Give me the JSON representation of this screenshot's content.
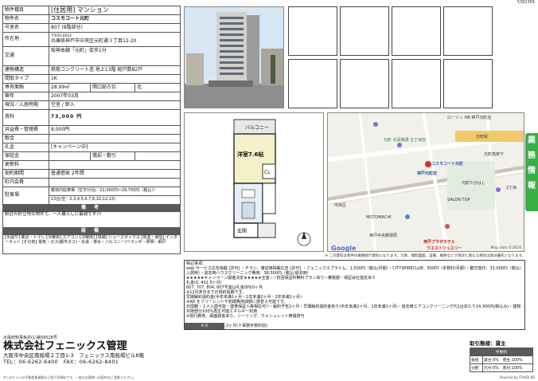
{
  "doc_id": "5382356",
  "property": {
    "rows": [
      {
        "key": "物件種目",
        "value": "[住居用] マンション"
      },
      {
        "key": "物件名",
        "value": "コスモコート元町"
      },
      {
        "key": "号室名",
        "value": "807 (8階部分)"
      },
      {
        "key": "所在地",
        "postal": "〒650-0022",
        "value": "兵庫県神戸市中央区元町通３丁目12-20"
      },
      {
        "key": "交通",
        "value": "阪神本線「元町」徒歩1分"
      },
      {
        "key": "建物構造",
        "value": "鉄筋コンクリート造 地上13階 総戸数82戸"
      },
      {
        "key": "間取タイプ",
        "value": "1K"
      },
      {
        "key": "専有面積",
        "value": "28.99㎡",
        "key2": "開口部方位",
        "value2": "北"
      },
      {
        "key": "築年",
        "value": "2007年03月"
      },
      {
        "key": "現況／入居時期",
        "value": "空室 / 即入"
      },
      {
        "key": "賃料",
        "value": "73,000 円"
      },
      {
        "key": "共益費・管理費",
        "value": "8,000円"
      },
      {
        "key": "敷金",
        "value": ""
      },
      {
        "key": "礼金",
        "value": "[キャンペーン中]"
      },
      {
        "key": "保証金",
        "value": "",
        "key2": "償却・敷引",
        "value2": ""
      },
      {
        "key": "更新料",
        "value": ""
      },
      {
        "key": "契約期間",
        "value": "普通借家 2年間"
      },
      {
        "key": "町内会費",
        "value": ""
      },
      {
        "key": "駐車場",
        "value": "敷地内駐車場（空き10台／22,000円～29,700円（税込））",
        "value_b": "13台(空：2,3,4,5,6,7,8,10,12,13)"
      }
    ],
    "remarks_header": "備 考",
    "remarks_text": "駅近の好立地な物件で、一人暮らしに最適です!!!",
    "facilities_header": "設 備",
    "facilities_text": "[水廻り] 風呂・トイレ [冷暖房] エアコン [冷暖房] [収納] シューズボックス [放送・通信] インターネット [その他] 電気・ガス(都市ガス)・水道・排水・バルコニー/ベランダ・照明・網戸"
  },
  "plan": {
    "balcony": "バルコニー",
    "room": "洋室7.6帖",
    "cl": "CL",
    "entrance": "玄関"
  },
  "map": {
    "labels": [
      {
        "t": "ローソン HB 神戸元町店",
        "c": "red"
      },
      {
        "t": "コスモコート元町",
        "c": "blue"
      },
      {
        "t": "元町 北長狭通 五丁目店",
        "c": "blue"
      },
      {
        "t": "神戸元町店",
        "c": "blue"
      },
      {
        "t": "神戸プラザホテル",
        "c": "red"
      },
      {
        "t": "ウエストジュエリー",
        "c": "red"
      },
      {
        "t": "元町駅",
        "c": ""
      },
      {
        "t": "中央区",
        "c": ""
      },
      {
        "t": "MOTOMACHI",
        "c": ""
      },
      {
        "t": "SALON TOP",
        "c": ""
      },
      {
        "t": "元町たかはし",
        "c": ""
      },
      {
        "t": "2丁目",
        "c": ""
      },
      {
        "t": "神戸中央郵便局",
        "c": ""
      },
      {
        "t": "元町高架下",
        "c": ""
      }
    ],
    "brand": "Google",
    "copyright": "Map data ©2024"
  },
  "note": "※ この資料は物件の概略紹介資料になります。写真、間取図面、設備、概要などが現況と異なる場合は現況優先となります。",
  "side_tab": [
    "業",
    "務",
    "情",
    "報"
  ],
  "special": {
    "title": "特記事項：",
    "lines": [
      "web サービス広告掲載 [許可] ・チラシ、雑誌等掲載広告 [許可] ・フェニックスプライム：1,500円（税込/月額）・CITYSPIRECLUB：500円（手数料/月額）・鍵交換代：33,000円（税込/入居時）・退去時ハウスクリーニング費用：38,500円（税込/退去時）",
      "★★★★★キャンペーン開催決定★★★★★全室☆☆初回保証料無料プランあり☆乗税額・保証会社指定あり",
      "礼金(0, 402.5ヶ月)",
      "607, 707, 804, 807号室は礼金0円(0ヶ月",
      "※12月末日までの契約始期です。",
      "早期解約違約金(半年未満1ヶ月・1年未満2ヶ月・2年未満1ヶ月)",
      "※AD をフリーレントや初期費用減額に振替え可能です。",
      "外国籍・２人入居可能・連帯保証人等相応可!!・解約予告2ヶ月・早期解約違約金有り(半年未満2ヶ月、1年未満1ヶ月)・退去時エアコンクリーニング代1台あたり14,300円(税込み)・建物共用部分100%再生可能エネルギー利用",
      "※現行教育、図面取扱あり。シーリング、ウォシュレット無償貸与"
    ],
    "ad_label": "A D",
    "ad_value": "2ヶ月(十事務手数料別)"
  },
  "company": {
    "license": "大阪府知事免許(1)第58528号",
    "name": "株式会社フェニックス管理",
    "address": "大阪市中央区南船場２丁目1-3　フェニックス南船場ビル8階",
    "tel_fax": "TEL：06-6262-6400　FAX：06-6262-8401"
  },
  "trade": {
    "title": "取引態様：貸主",
    "fee_header": "手数料",
    "rows": [
      {
        "k": "負担",
        "v": "貸主:0%　借主:100%"
      },
      {
        "k": "分配",
        "v": "元付:0%　客付:100%"
      }
    ]
  },
  "footer": "※このチラシは不動産業者間のご紹介用資料です。一般のお客様への配布はご遠慮ください。",
  "footer_right": "Powered by ITANDI BB"
}
